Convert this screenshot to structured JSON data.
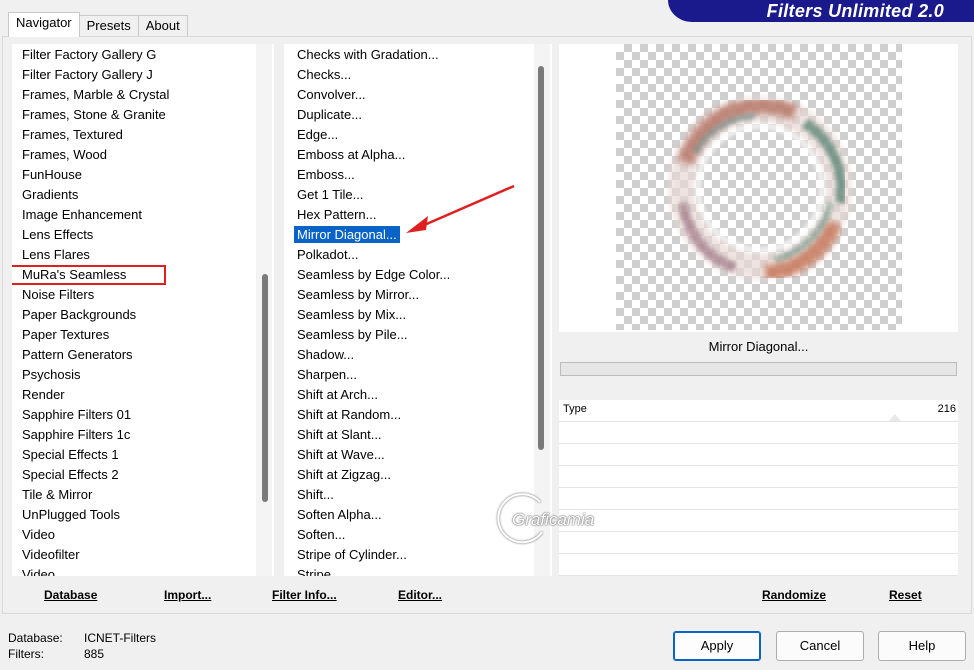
{
  "tabs": [
    "Navigator",
    "Presets",
    "About"
  ],
  "banner_title": "Filters Unlimited 2.0",
  "categories": [
    "Filter Factory Gallery G",
    "Filter Factory Gallery J",
    "Frames, Marble & Crystal",
    "Frames, Stone & Granite",
    "Frames, Textured",
    "Frames, Wood",
    "FunHouse",
    "Gradients",
    "Image Enhancement",
    "Lens Effects",
    "Lens Flares",
    "MuRa's Seamless",
    "Noise Filters",
    "Paper Backgrounds",
    "Paper Textures",
    "Pattern Generators",
    "Psychosis",
    "Render",
    "Sapphire Filters 01",
    "Sapphire Filters 1c",
    "Special Effects 1",
    "Special Effects 2",
    "Tile & Mirror",
    "UnPlugged Tools",
    "Video",
    "Videofilter",
    "Video..."
  ],
  "selected_category": "MuRa's Seamless",
  "filters": [
    "Checks with Gradation...",
    "Checks...",
    "Convolver...",
    "Duplicate...",
    "Edge...",
    "Emboss at Alpha...",
    "Emboss...",
    "Get 1 Tile...",
    "Hex Pattern...",
    "Mirror Diagonal...",
    "Polkadot...",
    "Seamless by Edge Color...",
    "Seamless by Mirror...",
    "Seamless by Mix...",
    "Seamless by Pile...",
    "Shadow...",
    "Sharpen...",
    "Shift at Arch...",
    "Shift at Random...",
    "Shift at Slant...",
    "Shift at Wave...",
    "Shift at Zigzag...",
    "Shift...",
    "Soften Alpha...",
    "Soften...",
    "Stripe of Cylinder...",
    "Stripe..."
  ],
  "selected_filter": "Mirror Diagonal...",
  "toolbar": {
    "database": "Database",
    "import": "Import...",
    "filter_info": "Filter Info...",
    "editor": "Editor..."
  },
  "preview": {
    "filter_name": "Mirror Diagonal...",
    "params": [
      {
        "name": "Type",
        "value": "216"
      }
    ]
  },
  "right_toolbar": {
    "randomize": "Randomize",
    "reset": "Reset"
  },
  "status": {
    "database_label": "Database:",
    "database_value": "ICNET-Filters",
    "filters_label": "Filters:",
    "filters_value": "885"
  },
  "buttons": {
    "apply": "Apply",
    "cancel": "Cancel",
    "help": "Help"
  },
  "watermark": "Graficamia",
  "colors": {
    "selection": "#0a64c8",
    "marker": "#e02020",
    "banner": "#1a1a8c"
  }
}
